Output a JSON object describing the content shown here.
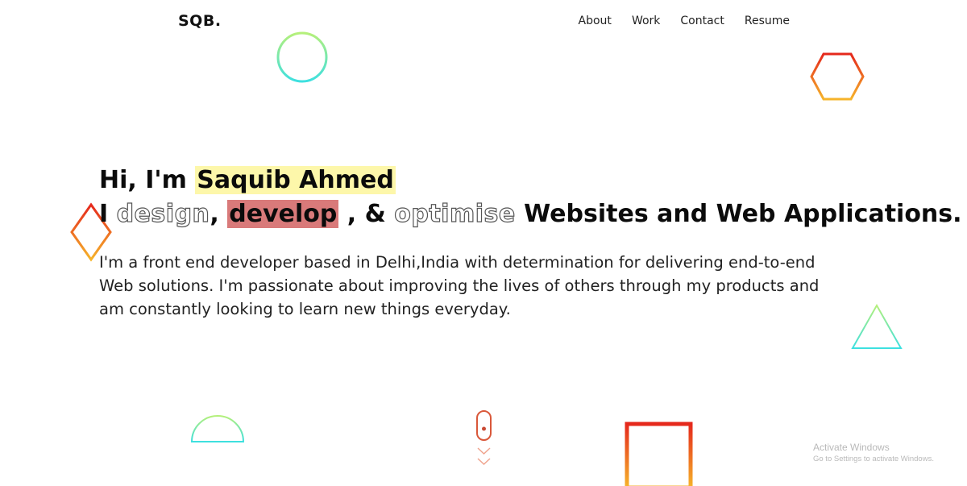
{
  "nav": {
    "logo": "SQB.",
    "links": [
      "About",
      "Work",
      "Contact",
      "Resume"
    ]
  },
  "hero": {
    "greeting_prefix": "Hi, I'm ",
    "name": "Saquib Ahmed",
    "line2_prefix": "I ",
    "word_design": "design",
    "sep1": ", ",
    "word_develop": "develop",
    "sep2": " , & ",
    "word_optimise": "optimise",
    "line2_suffix": " Websites and Web Applications.",
    "description": "I'm a front end developer based in Delhi,India with determination for delivering end-to-end Web solutions. I'm passionate about improving the lives of others through my products and am constantly looking to learn new things everyday."
  },
  "watermark": {
    "title": "Activate Windows",
    "subtitle": "Go to Settings to activate Windows."
  },
  "colors": {
    "name_highlight": "#fdf7aa",
    "develop_highlight": "#d97a7a",
    "cyan_green": [
      "#b5f07a",
      "#3de0e0"
    ],
    "red_orange": [
      "#e5281c",
      "#f6b42a"
    ]
  },
  "icons": [
    "circle-shape",
    "hexagon-shape",
    "diamond-shape",
    "triangle-shape",
    "semicircle-shape",
    "square-shape",
    "mouse-scroll-icon",
    "chevron-down-icon"
  ]
}
